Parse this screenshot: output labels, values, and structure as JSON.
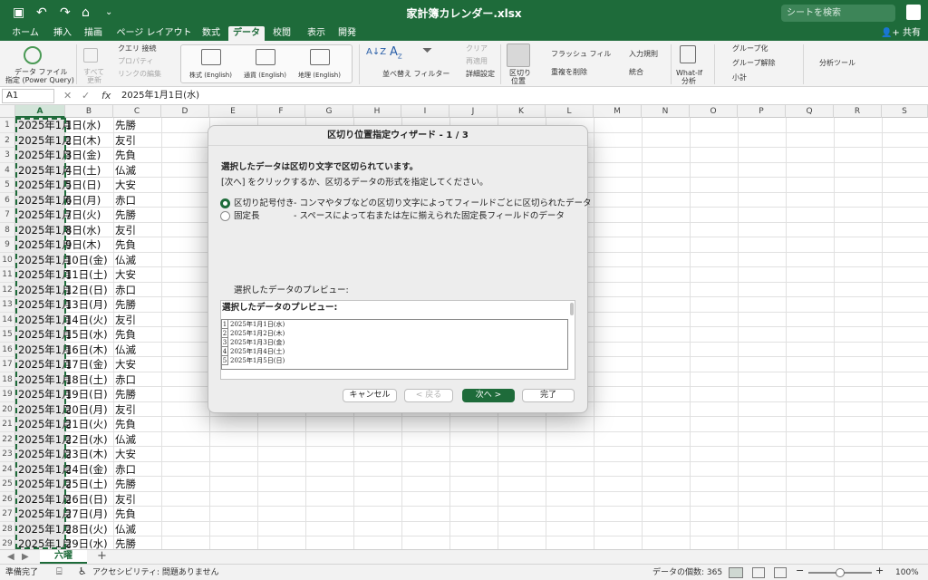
{
  "titlebar": {
    "doc_title": "家計簿カレンダー.xlsx",
    "search_placeholder": "シートを検索",
    "qa_icons": [
      "save-icon",
      "undo-icon",
      "redo-icon",
      "home-icon",
      "customize-icon"
    ]
  },
  "tabs": [
    {
      "label": "ホーム"
    },
    {
      "label": "挿入"
    },
    {
      "label": "描画"
    },
    {
      "label": "ページ レイアウト"
    },
    {
      "label": "数式"
    },
    {
      "label": "データ",
      "active": true
    },
    {
      "label": "校閲"
    },
    {
      "label": "表示"
    },
    {
      "label": "開発"
    }
  ],
  "share_label": "共有",
  "ribbon": {
    "get_data": "データ ファイル",
    "get_data_sub": "指定 (Power Query)",
    "refresh": "すべて",
    "refresh_sub": "更新",
    "query_conn": "クエリ  接続",
    "properties": "プロパティ",
    "edit_links": "リンクの編集",
    "stocks": "株式 (English)",
    "currencies": "通貨 (English)",
    "geography": "地理 (English)",
    "sort_filter": "並べ替え  フィルター",
    "clear": "クリア",
    "reapply": "再適用",
    "advanced": "詳細設定",
    "text_to_cols": "区切り",
    "text_to_cols_sub": "位置",
    "flash_fill": "フラッシュ フィル",
    "remove_dupes": "重複を削除",
    "validation": "入力規則",
    "consolidate": "統合",
    "whatif": "What-If",
    "whatif_sub": "分析",
    "group": "グループ化",
    "ungroup": "グループ解除",
    "subtotal": "小計",
    "analysis": "分析ツール"
  },
  "formula_bar": {
    "name_box": "A1",
    "fx": "fx",
    "content": "2025年1月1日(水)"
  },
  "columns": [
    "A",
    "B",
    "C",
    "D",
    "E",
    "F",
    "G",
    "H",
    "I",
    "J",
    "K",
    "L",
    "M",
    "N",
    "O",
    "P",
    "Q",
    "R",
    "S"
  ],
  "rows": [
    {
      "n": "1",
      "a": "2025年1月",
      "b": "1日(水)",
      "c": "先勝"
    },
    {
      "n": "2",
      "a": "2025年1月",
      "b": "2日(木)",
      "c": "友引"
    },
    {
      "n": "3",
      "a": "2025年1月",
      "b": "3日(金)",
      "c": "先負"
    },
    {
      "n": "4",
      "a": "2025年1月",
      "b": "4日(土)",
      "c": "仏滅"
    },
    {
      "n": "5",
      "a": "2025年1月",
      "b": "5日(日)",
      "c": "大安"
    },
    {
      "n": "6",
      "a": "2025年1月",
      "b": "6日(月)",
      "c": "赤口"
    },
    {
      "n": "7",
      "a": "2025年1月",
      "b": "7日(火)",
      "c": "先勝"
    },
    {
      "n": "8",
      "a": "2025年1月",
      "b": "8日(水)",
      "c": "友引"
    },
    {
      "n": "9",
      "a": "2025年1月",
      "b": "9日(木)",
      "c": "先負"
    },
    {
      "n": "10",
      "a": "2025年1月",
      "b": "10日(金)",
      "c": "仏滅"
    },
    {
      "n": "11",
      "a": "2025年1月",
      "b": "11日(土)",
      "c": "大安"
    },
    {
      "n": "12",
      "a": "2025年1月",
      "b": "12日(日)",
      "c": "赤口"
    },
    {
      "n": "13",
      "a": "2025年1月",
      "b": "13日(月)",
      "c": "先勝"
    },
    {
      "n": "14",
      "a": "2025年1月",
      "b": "14日(火)",
      "c": "友引"
    },
    {
      "n": "15",
      "a": "2025年1月",
      "b": "15日(水)",
      "c": "先負"
    },
    {
      "n": "16",
      "a": "2025年1月",
      "b": "16日(木)",
      "c": "仏滅"
    },
    {
      "n": "17",
      "a": "2025年1月",
      "b": "17日(金)",
      "c": "大安"
    },
    {
      "n": "18",
      "a": "2025年1月",
      "b": "18日(土)",
      "c": "赤口"
    },
    {
      "n": "19",
      "a": "2025年1月",
      "b": "19日(日)",
      "c": "先勝"
    },
    {
      "n": "20",
      "a": "2025年1月",
      "b": "20日(月)",
      "c": "友引"
    },
    {
      "n": "21",
      "a": "2025年1月",
      "b": "21日(火)",
      "c": "先負"
    },
    {
      "n": "22",
      "a": "2025年1月",
      "b": "22日(水)",
      "c": "仏滅"
    },
    {
      "n": "23",
      "a": "2025年1月",
      "b": "23日(木)",
      "c": "大安"
    },
    {
      "n": "24",
      "a": "2025年1月",
      "b": "24日(金)",
      "c": "赤口"
    },
    {
      "n": "25",
      "a": "2025年1月",
      "b": "25日(土)",
      "c": "先勝"
    },
    {
      "n": "26",
      "a": "2025年1月",
      "b": "26日(日)",
      "c": "友引"
    },
    {
      "n": "27",
      "a": "2025年1月",
      "b": "27日(月)",
      "c": "先負"
    },
    {
      "n": "28",
      "a": "2025年1月",
      "b": "28日(火)",
      "c": "仏滅"
    },
    {
      "n": "29",
      "a": "2025年1月",
      "b": "29日(水)",
      "c": "先勝"
    }
  ],
  "sheet": {
    "tab": "六曜"
  },
  "status": {
    "ready": "準備完了",
    "accessibility": "アクセシビリティ: 問題ありません",
    "count": "データの個数: 365",
    "zoom": "100%",
    "zoom_level": 1.0
  },
  "dialog": {
    "title": "区切り位置指定ウィザード - 1 / 3",
    "line1": "選択したデータは区切り文字で区切られています。",
    "line2": "[次へ] をクリックするか、区切るデータの形式を指定してください。",
    "opt1_label": "区切り記号付き",
    "opt1_desc": "- コンマやタブなどの区切り文字によってフィールドごとに区切られたデータ",
    "opt2_label": "固定長",
    "opt2_desc": "- スペースによって右または左に揃えられた固定長フィールドのデータ",
    "preview_label": "選択したデータのプレビュー:",
    "preview_heading": "選択したデータのプレビュー:",
    "preview_rows": [
      {
        "n": "1",
        "t": "2025年1月1日(水)"
      },
      {
        "n": "2",
        "t": "2025年1月2日(木)"
      },
      {
        "n": "3",
        "t": "2025年1月3日(金)"
      },
      {
        "n": "4",
        "t": "2025年1月4日(土)"
      },
      {
        "n": "5",
        "t": "2025年1月5日(日)"
      }
    ],
    "btn_cancel": "キャンセル",
    "btn_back": "< 戻る",
    "btn_next": "次へ >",
    "btn_finish": "完了"
  },
  "colors": {
    "accent": "#1e6b3a",
    "ribbon": "#f3f3f3"
  }
}
